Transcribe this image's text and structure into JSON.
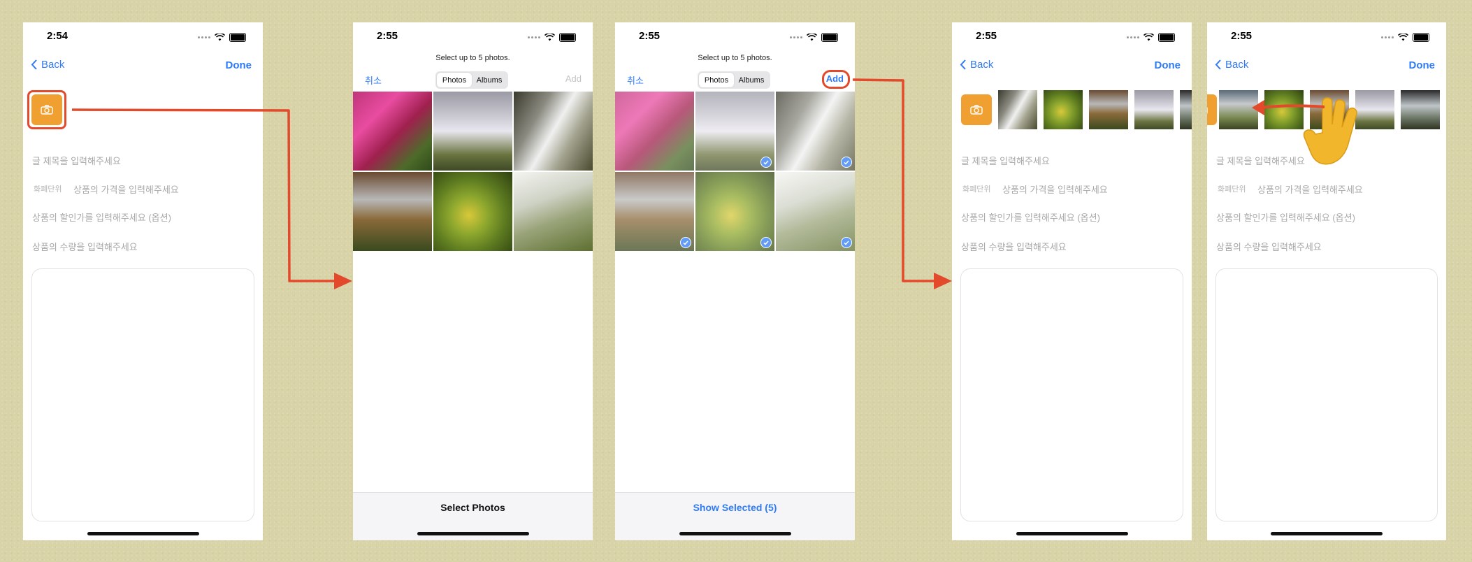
{
  "common": {
    "back": "Back",
    "done": "Done",
    "title_placeholder": "글 제목을 입력해주세요",
    "currency_unit": "화폐단위",
    "price_placeholder": "상품의 가격을 입력해주세요",
    "discount_placeholder": "상품의 할인가를 입력해주세요 (옵션)",
    "stock_placeholder": "상품의 수량을 입력해주세요"
  },
  "screen1": {
    "time": "2:54"
  },
  "screen2": {
    "time": "2:55",
    "title": "Select up to 5 photos.",
    "cancel": "취소",
    "tab_photos": "Photos",
    "tab_albums": "Albums",
    "add": "Add",
    "bottom_label": "Select Photos"
  },
  "screen3": {
    "time": "2:55",
    "title": "Select up to 5 photos.",
    "cancel": "취소",
    "tab_photos": "Photos",
    "tab_albums": "Albums",
    "add": "Add",
    "bottom_label": "Show Selected (5)",
    "selected_cells": [
      1,
      2,
      3,
      4,
      5
    ]
  },
  "screen4": {
    "time": "2:55"
  },
  "screen5": {
    "time": "2:55"
  },
  "colors": {
    "accent_blue": "#2f7bf5",
    "camera_orange": "#f0a030",
    "highlight_red": "#e24a2b",
    "hand_yellow": "#f2b62c"
  },
  "icons": [
    "camera-icon",
    "chevron-left-icon",
    "wifi-icon",
    "battery-icon",
    "checkmark-icon",
    "hand-pointer-icon",
    "arrow-icon"
  ]
}
